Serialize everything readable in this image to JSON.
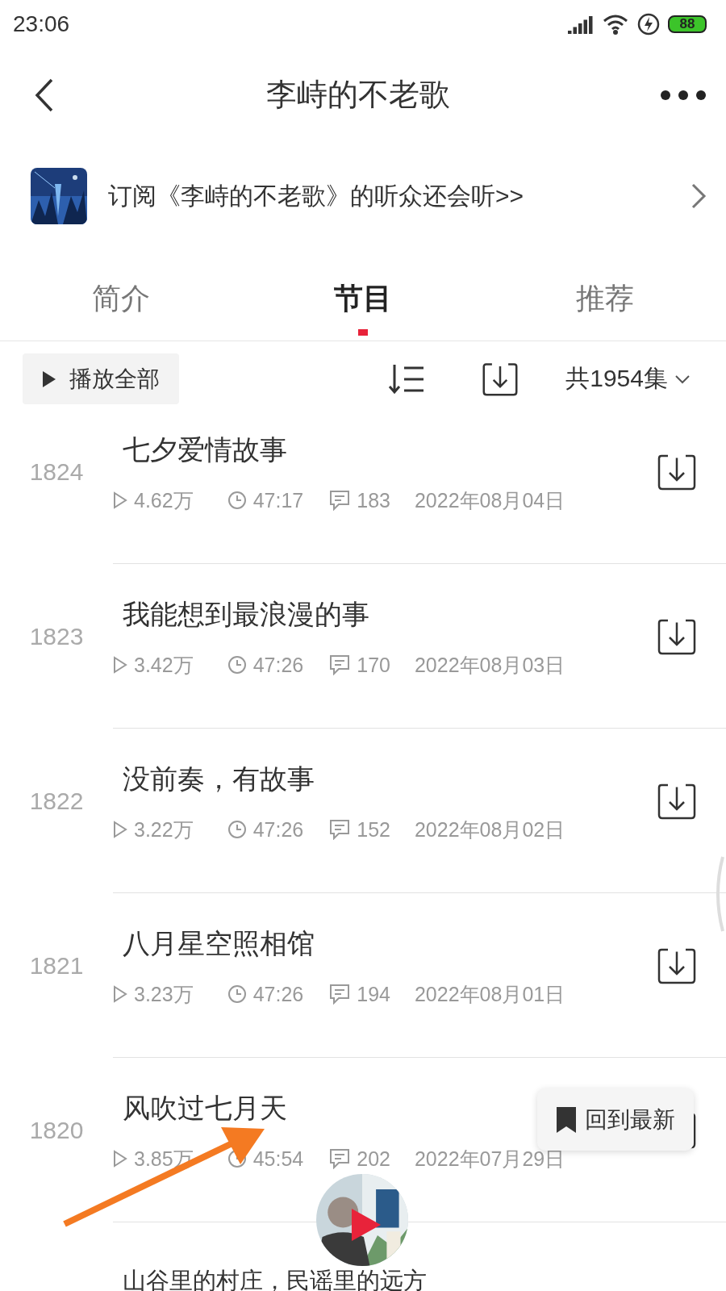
{
  "status_bar": {
    "time": "23:06",
    "battery": "88"
  },
  "header": {
    "title": "李峙的不老歌"
  },
  "banner": {
    "text": "订阅《李峙的不老歌》的听众还会听>>"
  },
  "tabs": [
    {
      "label": "简介",
      "selected": false
    },
    {
      "label": "节目",
      "selected": true
    },
    {
      "label": "推荐",
      "selected": false
    }
  ],
  "toolbar": {
    "play_all": "播放全部",
    "episode_count": "共1954集"
  },
  "episodes": [
    {
      "number": "1824",
      "title": "七夕爱情故事",
      "plays": "4.62万",
      "duration": "47:17",
      "comments": "183",
      "date": "2022年08月04日"
    },
    {
      "number": "1823",
      "title": "我能想到最浪漫的事",
      "plays": "3.42万",
      "duration": "47:26",
      "comments": "170",
      "date": "2022年08月03日"
    },
    {
      "number": "1822",
      "title": "没前奏，有故事",
      "plays": "3.22万",
      "duration": "47:26",
      "comments": "152",
      "date": "2022年08月02日"
    },
    {
      "number": "1821",
      "title": "八月星空照相馆",
      "plays": "3.23万",
      "duration": "47:26",
      "comments": "194",
      "date": "2022年08月01日"
    },
    {
      "number": "1820",
      "title": "风吹过七月天",
      "plays": "3.85万",
      "duration": "45:54",
      "comments": "202",
      "date": "2022年07月29日"
    },
    {
      "title": "山谷里的村庄，民谣里的远方"
    }
  ],
  "back_to_latest": "回到最新"
}
